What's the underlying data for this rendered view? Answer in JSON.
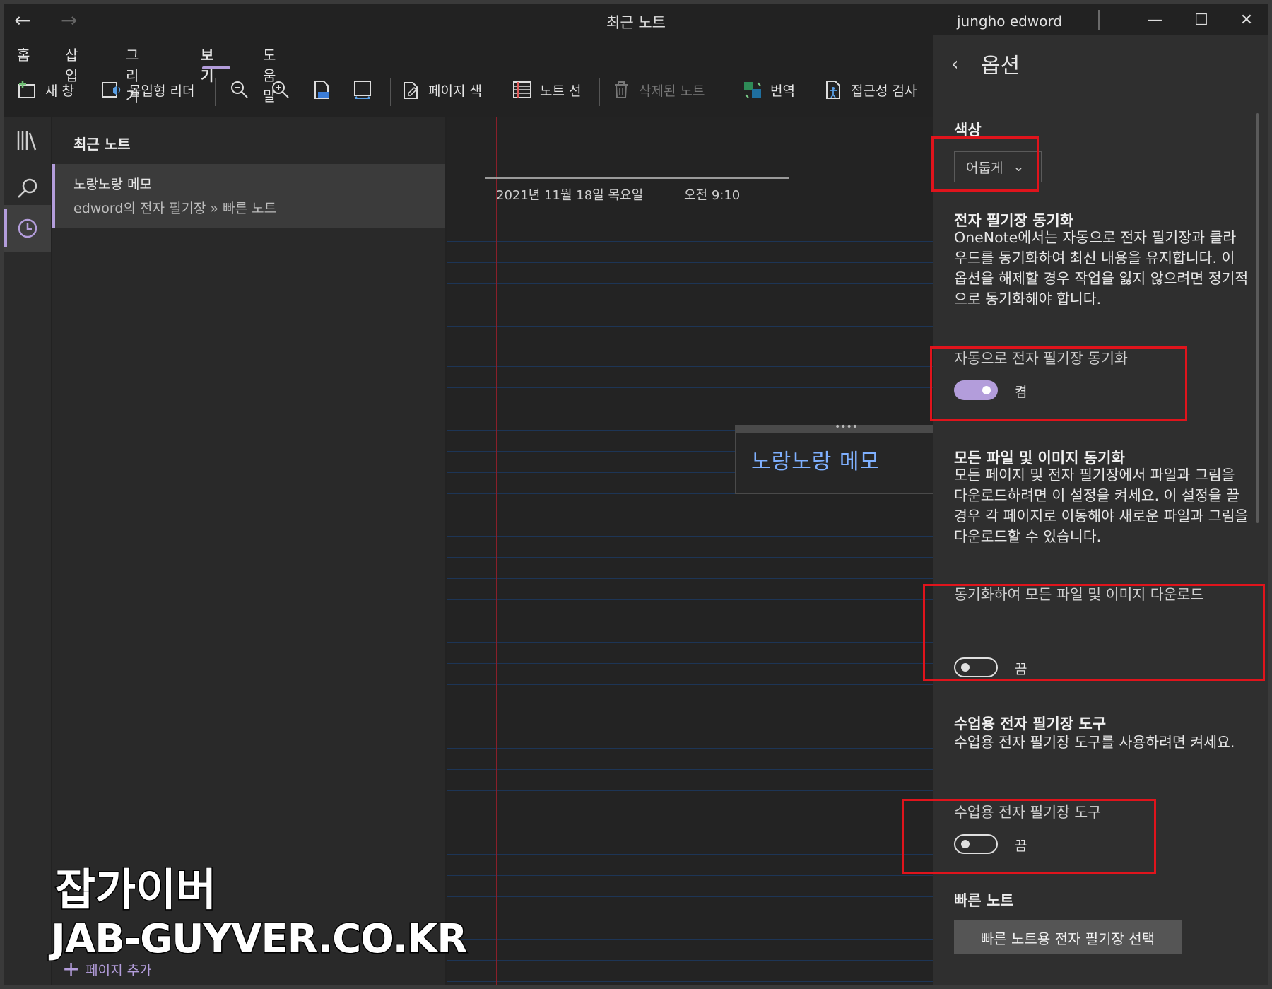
{
  "window": {
    "title": "최근 노트",
    "user": "jungho edword",
    "back_icon": "arrow-left-icon",
    "forward_icon": "arrow-right-icon"
  },
  "ribbon": {
    "tabs": [
      {
        "label": "홈"
      },
      {
        "label": "삽입"
      },
      {
        "label": "그리기"
      },
      {
        "label": "보기",
        "active": true
      },
      {
        "label": "도움말"
      }
    ],
    "tools": {
      "new_window": "새 창",
      "immersive_reader": "몰입형 리더",
      "page_color": "페이지 색",
      "rule_lines": "노트 선",
      "deleted_notes": "삭제된 노트",
      "translate": "번역",
      "accessibility": "접근성 검사"
    }
  },
  "page_list": {
    "title": "최근 노트",
    "item": {
      "title": "노랑노랑 메모",
      "path": "edword의 전자 필기장 » 빠른 노트"
    },
    "add_page": "페이지 추가"
  },
  "canvas": {
    "date": "2021년 11월 18일 목요일",
    "time": "오전 9:10",
    "note_text": "노랑노랑 메모"
  },
  "options": {
    "title": "옵션",
    "color": {
      "heading": "색상",
      "selected": "어둡게"
    },
    "sync": {
      "heading": "전자 필기장 동기화",
      "description": "OneNote에서는 자동으로 전자 필기장과 클라우드를 동기화하여 최신 내용을 유지합니다. 이 옵션을 해제할 경우 작업을 잃지 않으려면 정기적으로 동기화해야 합니다.",
      "toggle_label": "자동으로 전자 필기장 동기화",
      "state": "켬",
      "on": true
    },
    "files": {
      "heading": "모든 파일 및 이미지 동기화",
      "description": "모든 페이지 및 전자 필기장에서 파일과 그림을 다운로드하려면 이 설정을 켜세요. 이 설정을 끌 경우 각 페이지로 이동해야 새로운 파일과 그림을 다운로드할 수 있습니다.",
      "toggle_label": "동기화하여 모든 파일 및 이미지 다운로드",
      "state": "끔",
      "on": false
    },
    "class": {
      "heading": "수업용 전자 필기장 도구",
      "description": "수업용 전자 필기장 도구를 사용하려면 켜세요.",
      "toggle_label": "수업용 전자 필기장 도구",
      "state": "끔",
      "on": false
    },
    "quick": {
      "heading": "빠른 노트",
      "button": "빠른 노트용 전자 필기장 선택"
    },
    "accent_color": "#b39ddb",
    "annotation_color": "#e0141c"
  },
  "watermark": {
    "line1": "잡가이버",
    "line2": "JAB-GUYVER.CO.KR"
  }
}
